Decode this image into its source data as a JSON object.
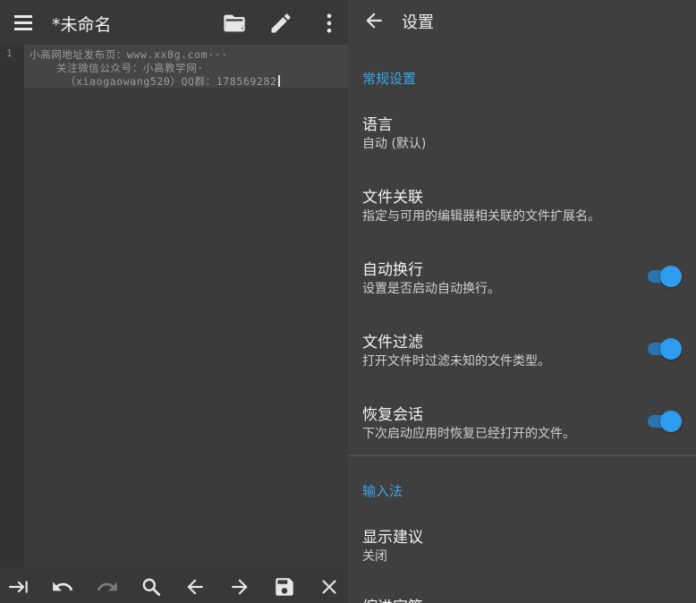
{
  "editor": {
    "title": "*未命名",
    "line_number": "1",
    "lines": [
      "小高网地址发布页：www.xx8g.com···",
      "关注微信公众号：小高教学网·",
      "（xiaogaowang520）QQ群：178569282"
    ],
    "toolbar_icons": [
      "menu-icon",
      "folder-open-icon",
      "pencil-icon",
      "more-vert-icon"
    ],
    "bottom_icons": [
      "tab-indent-icon",
      "undo-icon",
      "redo-icon",
      "search-icon",
      "arrow-left-icon",
      "arrow-right-icon",
      "save-icon",
      "close-icon"
    ]
  },
  "settings": {
    "title": "设置",
    "sections": [
      {
        "title": "常规设置",
        "items": [
          {
            "title": "语言",
            "summary": "自动 (默认)"
          },
          {
            "title": "文件关联",
            "summary": "指定与可用的编辑器相关联的文件扩展名。"
          },
          {
            "title": "自动换行",
            "summary": "设置是否启动自动换行。",
            "toggle": true
          },
          {
            "title": "文件过滤",
            "summary": "打开文件时过滤未知的文件类型。",
            "toggle": true
          },
          {
            "title": "恢复会话",
            "summary": "下次启动应用时恢复已经打开的文件。",
            "toggle": true
          }
        ]
      },
      {
        "title": "输入法",
        "items": [
          {
            "title": "显示建议",
            "summary": "关闭"
          },
          {
            "title": "缩进字符",
            "summary": ""
          }
        ]
      }
    ]
  },
  "colors": {
    "accent": "#3aa4e8",
    "switch_thumb": "#2e9df0",
    "switch_track": "#2a75b0",
    "editor_bg": "#3b3a3a",
    "settings_bg": "#3f3f3f"
  }
}
